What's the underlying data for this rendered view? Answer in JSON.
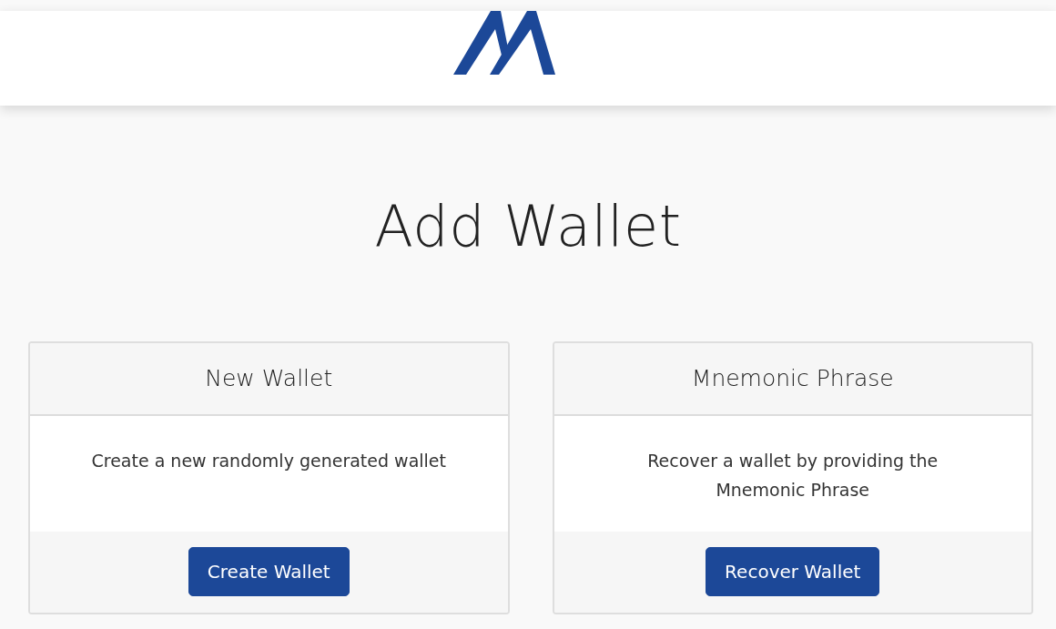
{
  "page": {
    "title": "Add Wallet"
  },
  "cards": [
    {
      "title": "New Wallet",
      "description_lines": [
        "Create a new randomly generated wallet"
      ],
      "button": "Create Wallet"
    },
    {
      "title": "Mnemonic Phrase",
      "description_lines": [
        "Recover a wallet by providing the",
        "Mnemonic Phrase"
      ],
      "button": "Recover Wallet"
    }
  ]
}
